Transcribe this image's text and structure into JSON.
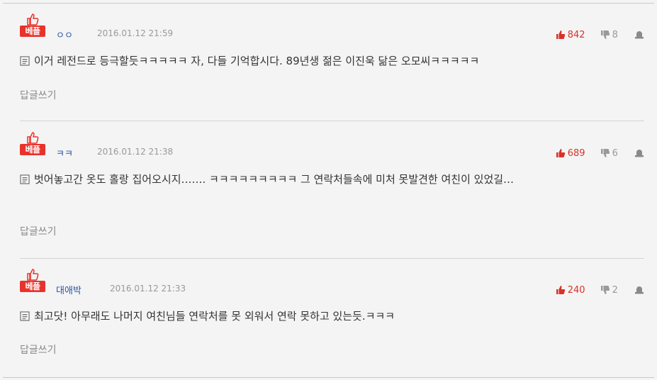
{
  "comments": [
    {
      "badge": "베플",
      "author": "ㅇㅇ",
      "date": "2016.01.12 21:59",
      "up": "842",
      "down": "8",
      "text": "이거 레전드로 등극할듯ㅋㅋㅋㅋㅋ 자, 다들 기억합시다. 89년생 젊은 이진욱 닮은 오모씨ㅋㅋㅋㅋㅋ",
      "reply": "답글쓰기"
    },
    {
      "badge": "베플",
      "author": "ㅋㅋ",
      "date": "2016.01.12 21:38",
      "up": "689",
      "down": "6",
      "text": "벗어놓고간 옷도 홀랑 집어오시지……. ㅋㅋㅋㅋㅋㅋㅋㅋㅋ 그 연락처들속에 미처 못발견한 여친이 있었길…",
      "reply": "답글쓰기"
    },
    {
      "badge": "베플",
      "author": "대애박",
      "date": "2016.01.12 21:33",
      "up": "240",
      "down": "2",
      "text": "최고닷! 아무래도 나머지 여친님들 연락처를 못 외워서 연락 못하고 있는듯.ㅋㅋㅋ",
      "reply": "답글쓰기"
    }
  ],
  "icons": {
    "best": "thumbs-up-icon",
    "up": "thumbs-up-icon",
    "down": "thumbs-down-icon",
    "report": "report-icon",
    "text": "document-icon"
  },
  "colors": {
    "badge": "#e8332c",
    "author": "#2a55a8",
    "up_count": "#d8322a"
  }
}
